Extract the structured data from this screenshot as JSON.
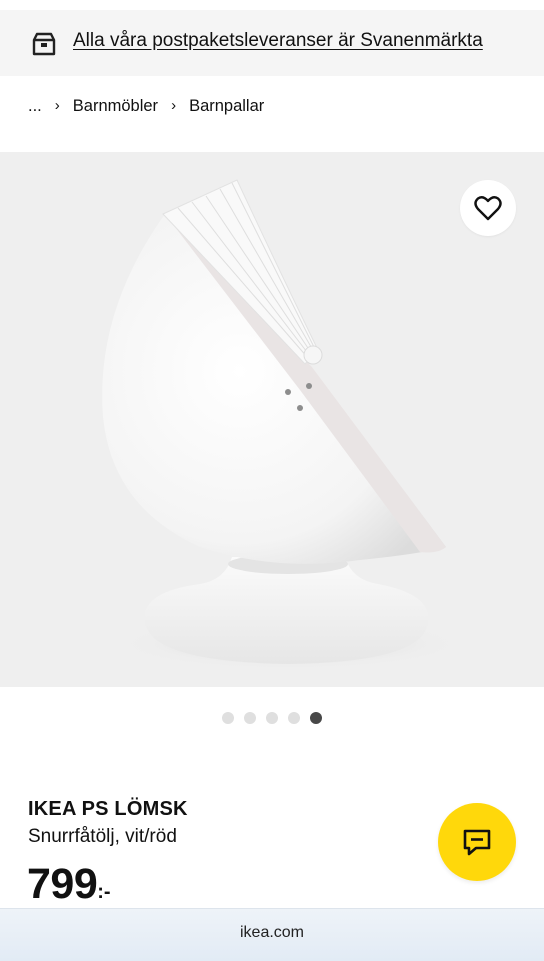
{
  "banner": {
    "text": "Alla våra postpaketsleveranser är Svanenmärkta",
    "icon": "delivery-box-icon"
  },
  "breadcrumb": {
    "ellipsis": "...",
    "items": [
      "Barnmöbler",
      "Barnpallar"
    ],
    "separator": "›"
  },
  "gallery": {
    "image_count": 5,
    "active_index": 4,
    "favorite_icon": "heart-outline-icon"
  },
  "product": {
    "name": "IKEA PS LÖMSK",
    "description": "Snurrfåtölj, vit/röd",
    "price": "799",
    "price_suffix": ":-"
  },
  "chat": {
    "icon": "chat-bubble-icon",
    "color": "#ffd80b"
  },
  "browser": {
    "url": "ikea.com"
  }
}
